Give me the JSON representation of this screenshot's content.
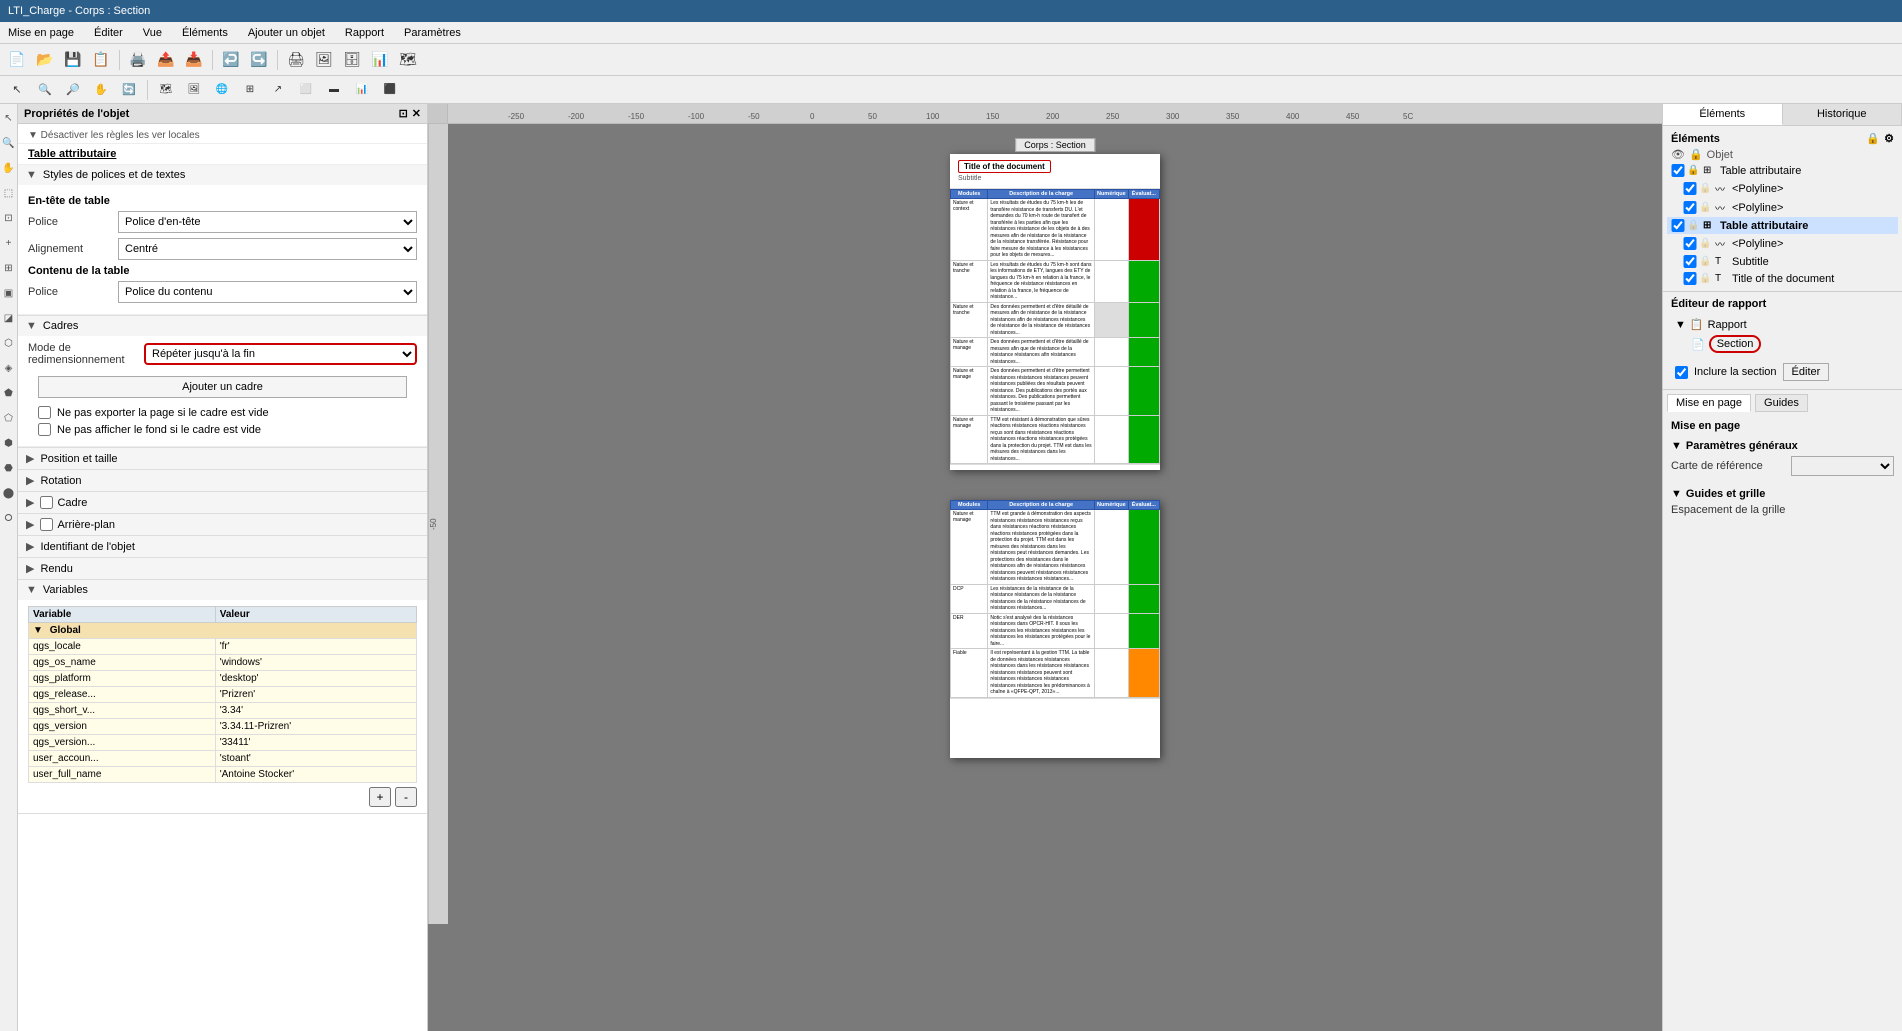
{
  "titleBar": {
    "text": "LTI_Charge - Corps : Section"
  },
  "menuBar": {
    "items": [
      "Mise en page",
      "Éditer",
      "Vue",
      "Éléments",
      "Ajouter un objet",
      "Rapport",
      "Paramètres"
    ]
  },
  "toolbar1": {
    "buttons": [
      "new",
      "open",
      "save",
      "save-as",
      "print",
      "export",
      "import",
      "undo",
      "redo",
      "print2",
      "export2",
      "import2",
      "zoom"
    ]
  },
  "toolbar2": {
    "buttons": [
      "select",
      "zoom-in",
      "zoom-out",
      "pan",
      "refresh",
      "add-map",
      "add-img",
      "add-html",
      "add-table",
      "add-arrow",
      "add-shape",
      "add-bar",
      "add-chart",
      "add-more"
    ]
  },
  "propsPanel": {
    "title": "Propriétés de l'objet",
    "sectionTitle": "Table attributaire",
    "stylesSection": {
      "label": "Styles de polices et de textes",
      "headerTable": {
        "label": "En-tête de table",
        "policeLabel": "Police",
        "policeValue": "Police d'en-tête",
        "alignLabel": "Alignement",
        "alignValue": "Centré"
      },
      "contentTable": {
        "label": "Contenu de la table",
        "policeLabel": "Police",
        "policeValue": "Police du contenu"
      }
    },
    "cadresSection": {
      "label": "Cadres",
      "modeLabel": "Mode de redimensionnement",
      "modeValue": "Répéter jusqu'à la fin",
      "addBtnLabel": "Ajouter un cadre",
      "checkbox1": "Ne pas exporter la page si le cadre est vide",
      "checkbox2": "Ne pas afficher le fond si le cadre est vide"
    },
    "collapsibles": [
      "Position et taille",
      "Rotation",
      "Cadre",
      "Arrière-plan",
      "Identifiant de l'objet",
      "Rendu"
    ],
    "variablesSection": {
      "label": "Variables",
      "columns": [
        "Variable",
        "Valeur"
      ],
      "global": {
        "label": "Global",
        "rows": [
          [
            "qgs_locale",
            "'fr'"
          ],
          [
            "qgs_os_name",
            "'windows'"
          ],
          [
            "qgs_platform",
            "'desktop'"
          ],
          [
            "qgs_release...",
            "'Prizren'"
          ],
          [
            "qgs_short_v...",
            "'3.34'"
          ],
          [
            "qgs_version",
            "'3.34.11-Prizren'"
          ],
          [
            "qgs_version...",
            "'33411'"
          ],
          [
            "user_accoun...",
            "'stoant'"
          ],
          [
            "user_full_name",
            "'Antoine Stocker'"
          ]
        ]
      },
      "addBtnIcon": "+",
      "removeBtnIcon": "-"
    }
  },
  "canvas": {
    "page1Label": "Corps : Section",
    "page1Title": "Title of the document",
    "page1Subtitle": "Subtitle",
    "tableHeaders": [
      "Modules",
      "Description de la charge",
      "Numérique",
      "Évaluat..."
    ],
    "page2TableHeaders": [
      "Modules",
      "Description de la charge",
      "Numérique",
      "Évaluat..."
    ]
  },
  "rightPanel": {
    "tabs": [
      "Éléments",
      "Historique"
    ],
    "activeTab": "Éléments",
    "elementsTitle": "Éléments",
    "elements": [
      {
        "type": "table",
        "label": "Table attributaire",
        "checked": true,
        "locked": true,
        "indent": 0
      },
      {
        "type": "polyline",
        "label": "<Polyline>",
        "checked": true,
        "locked": false,
        "indent": 1
      },
      {
        "type": "polyline",
        "label": "<Polyline>",
        "checked": true,
        "locked": false,
        "indent": 1
      },
      {
        "type": "table",
        "label": "Table attributaire",
        "checked": true,
        "locked": false,
        "bold": true,
        "indent": 0
      },
      {
        "type": "polyline",
        "label": "<Polyline>",
        "checked": true,
        "locked": false,
        "indent": 1
      },
      {
        "type": "text",
        "label": "Subtitle",
        "checked": true,
        "locked": false,
        "indent": 1
      },
      {
        "type": "text",
        "label": "Title of the document",
        "checked": true,
        "locked": false,
        "indent": 1
      }
    ],
    "reportEditor": {
      "title": "Éditeur de rapport",
      "rapport": "Rapport",
      "section": "Section",
      "includeSection": "Inclure la section",
      "editBtn": "Éditer"
    },
    "bottomTabs": [
      "Mise en page",
      "Guides"
    ],
    "activeBottomTab": "Mise en page",
    "miseEnPageTitle": "Mise en page",
    "parametresGeneraux": {
      "title": "Paramètres généraux",
      "carteRef": "Carte de référence",
      "carteRefValue": ""
    },
    "guidesGrille": {
      "title": "Guides et grille",
      "espacementLabel": "Espacement de la grille"
    }
  }
}
